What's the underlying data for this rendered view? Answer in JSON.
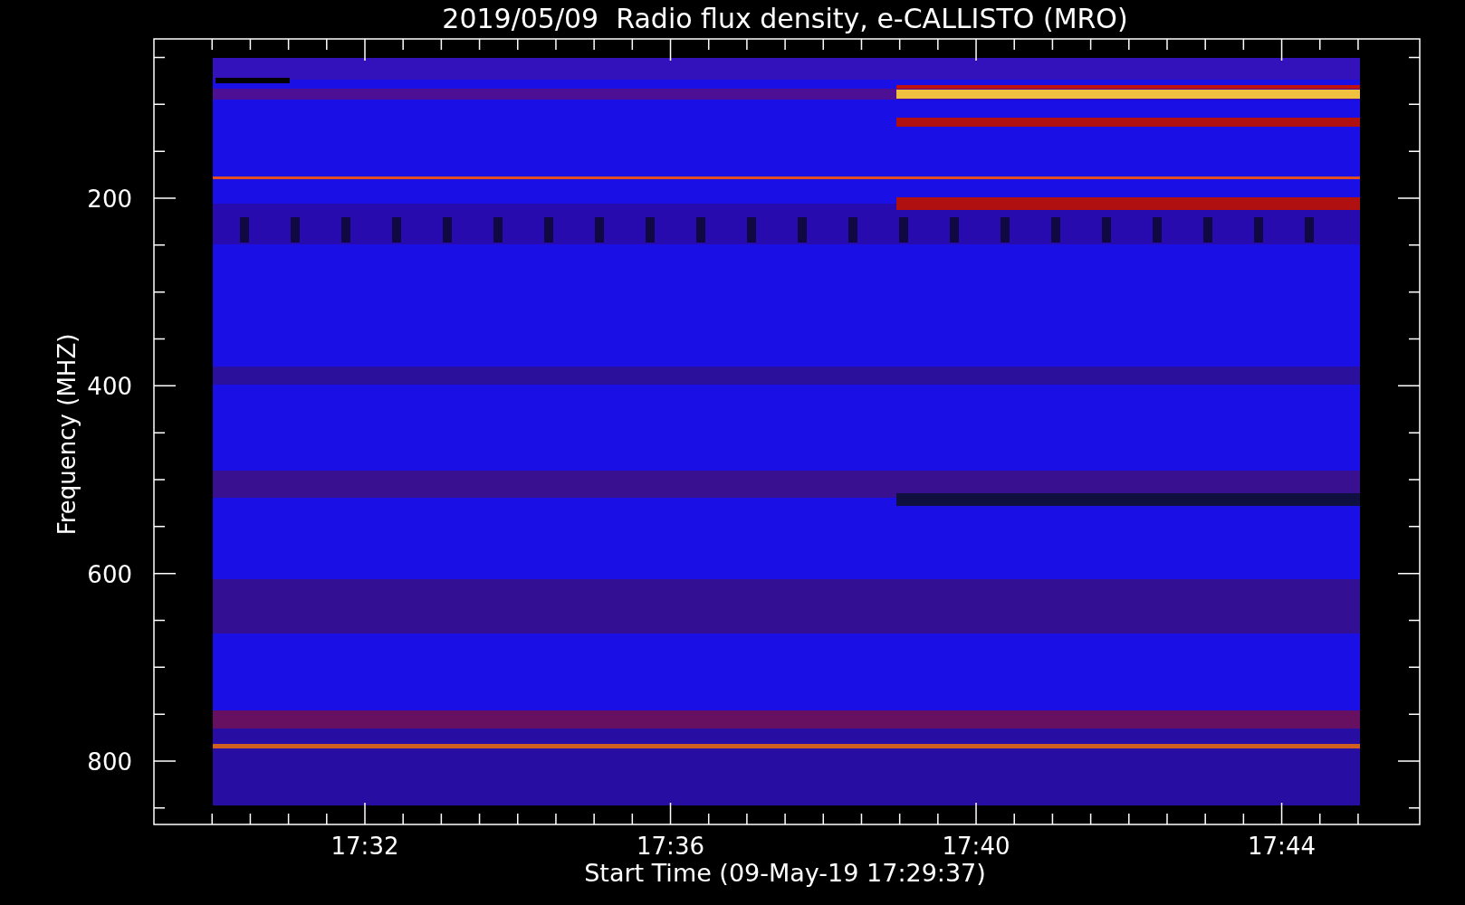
{
  "title": "2019/05/09  Radio flux density, e-CALLISTO (MRO)",
  "y_axis": {
    "label": "Frequency (MHZ)",
    "ticks": [
      "200",
      "400",
      "600",
      "800"
    ]
  },
  "x_axis": {
    "label": "Start Time (09-May-19 17:29:37)",
    "ticks": [
      "17:32",
      "17:36",
      "17:40",
      "17:44"
    ]
  }
}
